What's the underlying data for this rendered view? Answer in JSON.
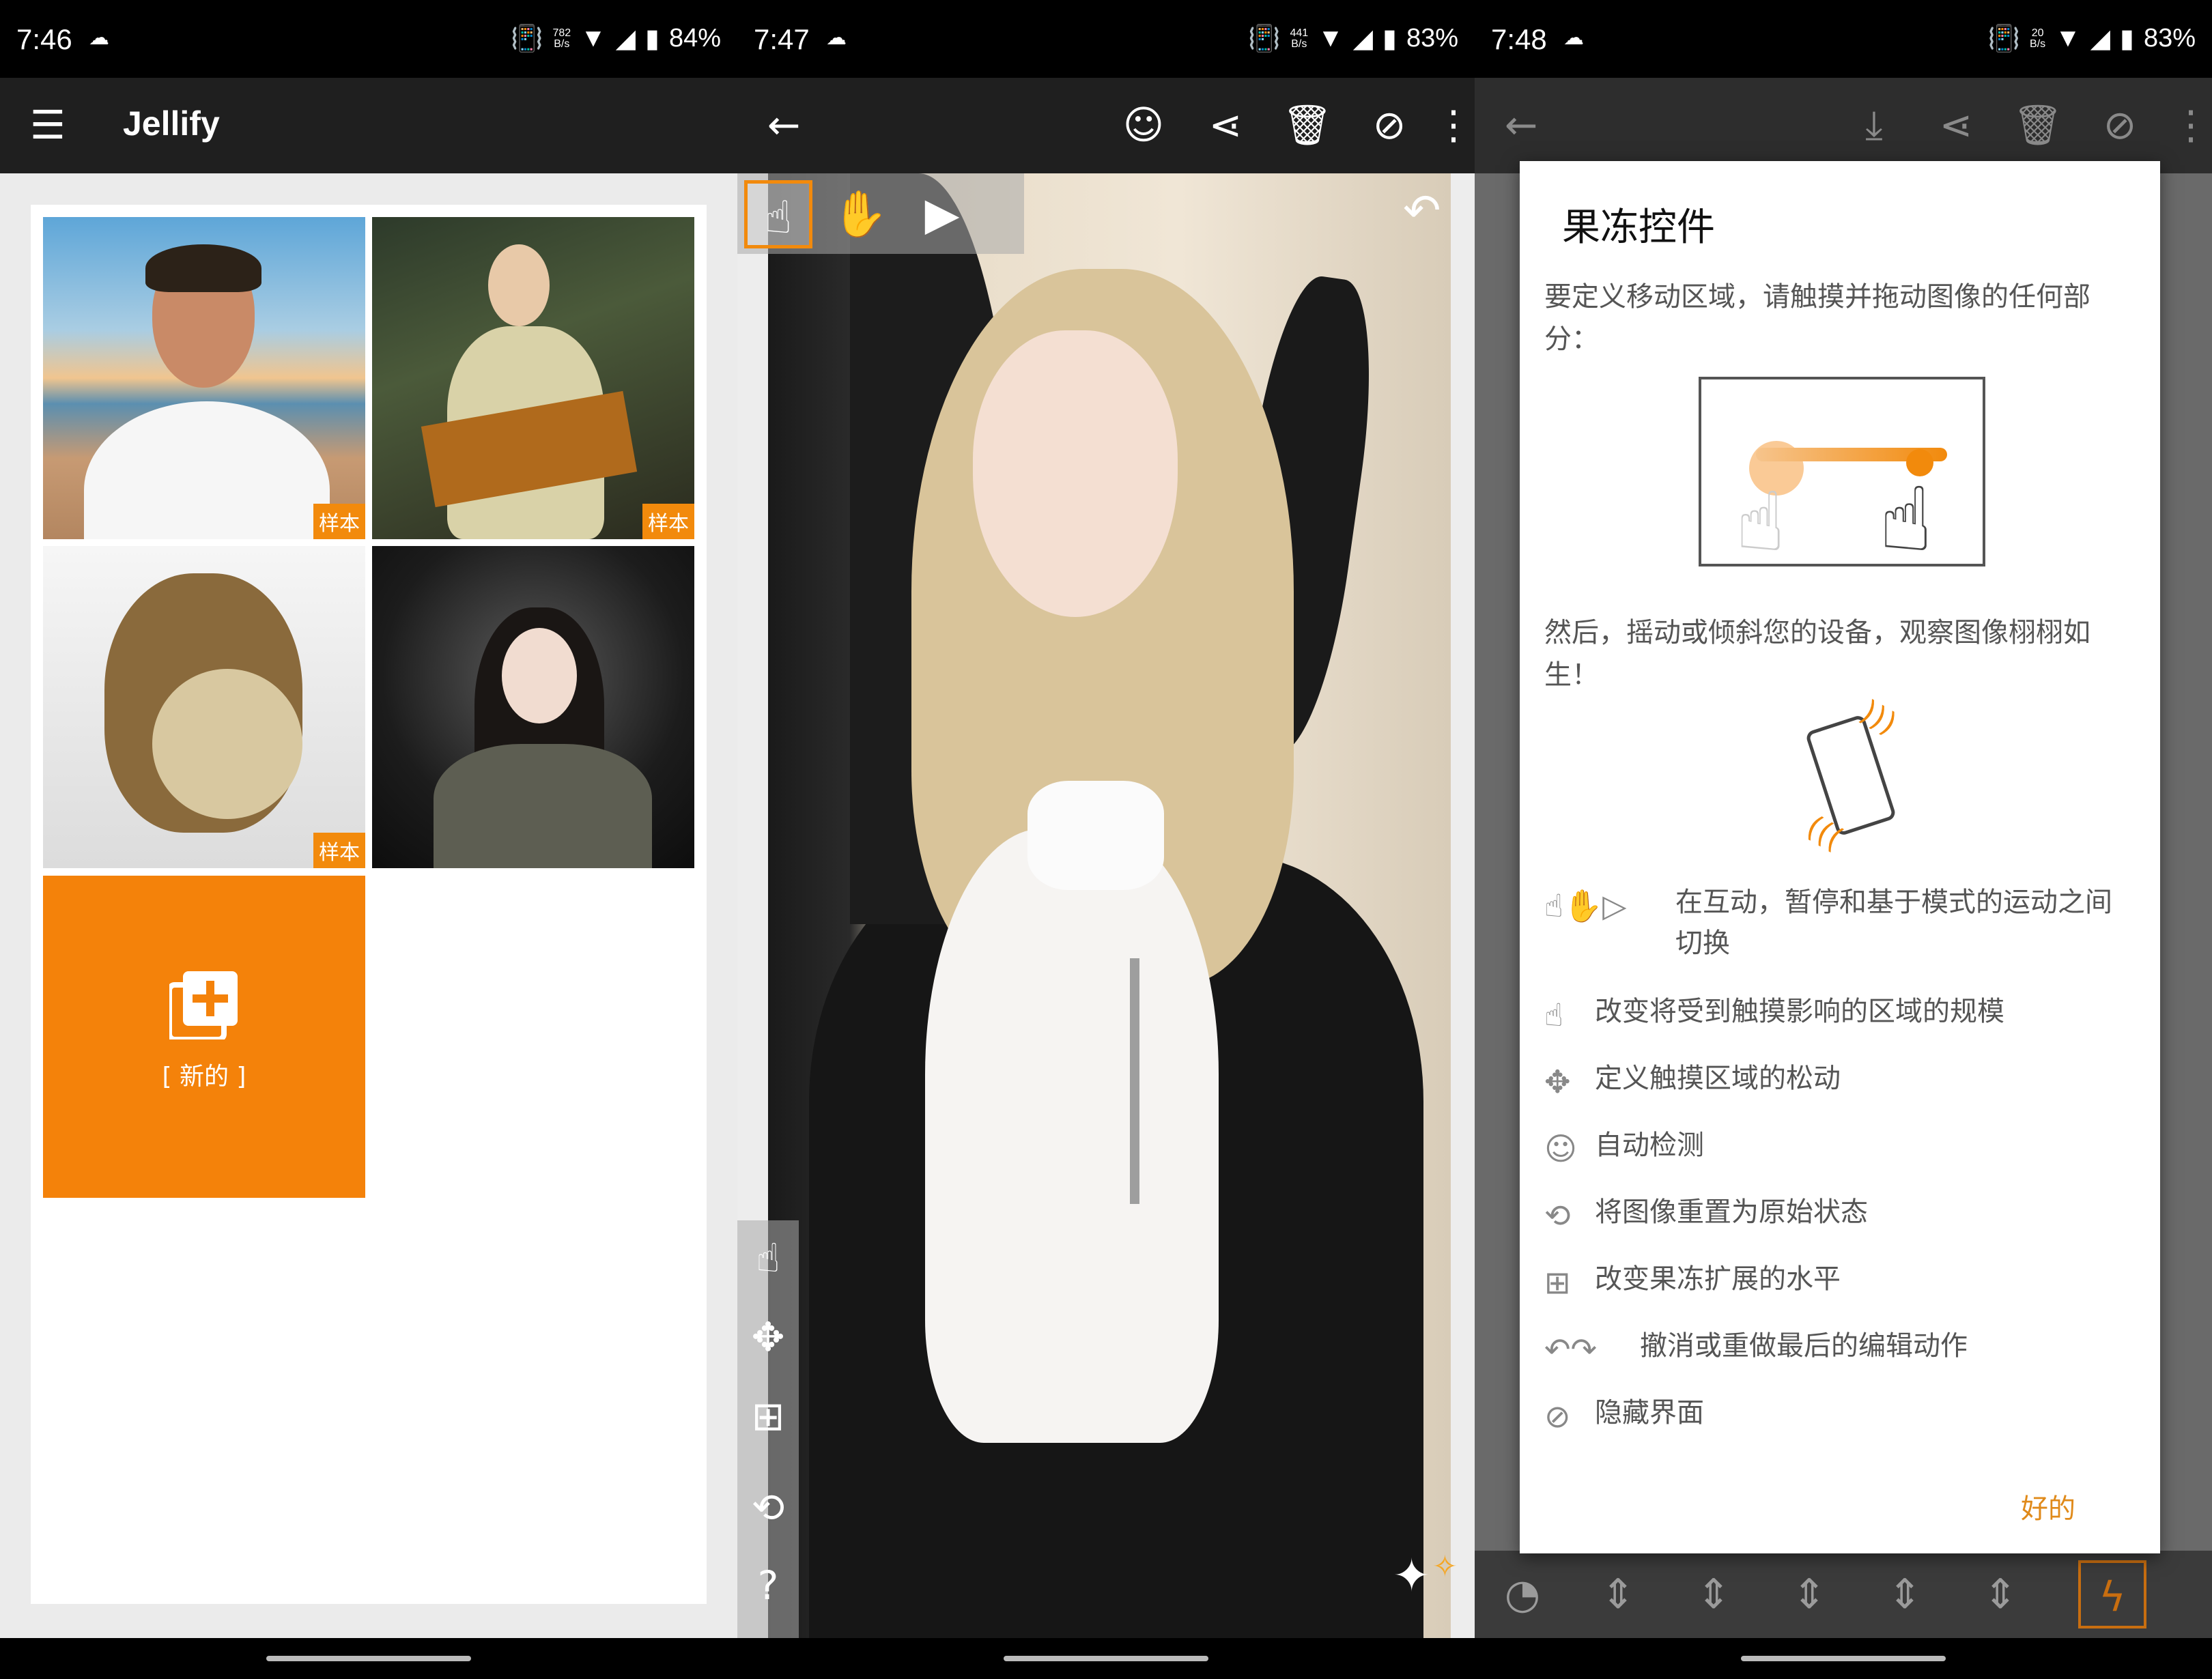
{
  "screens": [
    {
      "status": {
        "time": "7:46",
        "speed": "782\nB/s",
        "battery": "84%"
      },
      "toolbar": {
        "title": "Jellify"
      },
      "gallery": {
        "badges": [
          "样本",
          "样本",
          "样本"
        ],
        "new_label": "[ 新的 ]"
      }
    },
    {
      "status": {
        "time": "7:47",
        "speed": "441\nB/s",
        "battery": "83%"
      }
    },
    {
      "status": {
        "time": "7:48",
        "speed": "20\nB/s",
        "battery": "83%"
      },
      "dialog": {
        "title": "果冻控件",
        "intro": "要定义移动区域，请触摸并拖动图像的任何部分：",
        "then": "然后，摇动或倾斜您的设备，观察图像栩栩如生！",
        "items": [
          {
            "icon": "mode-toggle-icons",
            "text": "在互动，暂停和基于模式的运动之间切换"
          },
          {
            "icon": "touch-size-icon",
            "text": "改变将受到触摸影响的区域的规模"
          },
          {
            "icon": "touch-loose-icon",
            "text": "定义触摸区域的松动"
          },
          {
            "icon": "face-detect-icon",
            "text": "自动检测"
          },
          {
            "icon": "reset-icon",
            "text": "将图像重置为原始状态"
          },
          {
            "icon": "expand-icon",
            "text": "改变果冻扩展的水平"
          },
          {
            "icon": "undo-redo-icons",
            "text": "撤消或重做最后的编辑动作"
          },
          {
            "icon": "hide-ui-icon",
            "text": "隐藏界面"
          }
        ],
        "ok": "好的"
      }
    }
  ],
  "colors": {
    "accent": "#f28a0c",
    "toolbar": "#1f1f1f"
  }
}
